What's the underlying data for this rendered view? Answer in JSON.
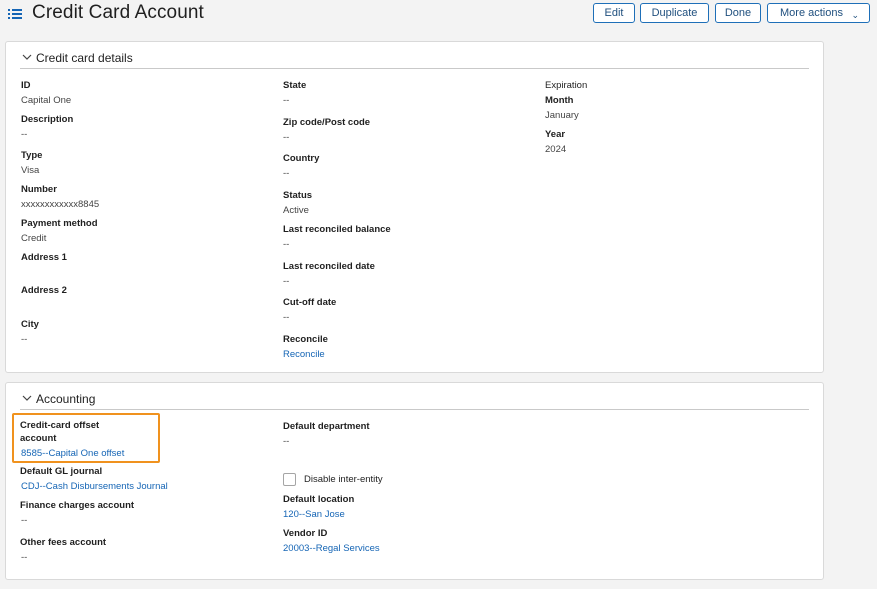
{
  "header": {
    "title": "Credit Card Account",
    "buttons": {
      "edit": "Edit",
      "duplicate": "Duplicate",
      "done": "Done",
      "more_actions": "More actions"
    }
  },
  "details": {
    "section_title": "Credit card details",
    "id": {
      "label": "ID",
      "value": "Capital One"
    },
    "description": {
      "label": "Description",
      "value": "--"
    },
    "type": {
      "label": "Type",
      "value": "Visa"
    },
    "number": {
      "label": "Number",
      "value": "xxxxxxxxxxxx8845"
    },
    "payment_method": {
      "label": "Payment method",
      "value": "Credit"
    },
    "address1": {
      "label": "Address 1"
    },
    "address2": {
      "label": "Address 2"
    },
    "city": {
      "label": "City",
      "value": "--"
    },
    "state": {
      "label": "State",
      "value": "--"
    },
    "zip": {
      "label": "Zip code/Post code",
      "value": "--"
    },
    "country": {
      "label": "Country",
      "value": "--"
    },
    "status": {
      "label": "Status",
      "value": "Active"
    },
    "last_reconciled_balance": {
      "label": "Last reconciled balance",
      "value": "--"
    },
    "last_reconciled_date": {
      "label": "Last reconciled date",
      "value": "--"
    },
    "cutoff_date": {
      "label": "Cut-off date",
      "value": "--"
    },
    "reconcile": {
      "label": "Reconcile",
      "value": "Reconcile"
    },
    "expiration": {
      "label": "Expiration"
    },
    "month": {
      "label": "Month",
      "value": "January"
    },
    "year": {
      "label": "Year",
      "value": "2024"
    }
  },
  "accounting": {
    "section_title": "Accounting",
    "offset_account": {
      "label_line1": "Credit-card offset",
      "label_line2": "account",
      "value": "8585--Capital One offset"
    },
    "gl_journal": {
      "label": "Default GL journal",
      "value": "CDJ--Cash Disbursements Journal"
    },
    "finance_charges": {
      "label": "Finance charges account",
      "value": "--"
    },
    "other_fees": {
      "label": "Other fees account",
      "value": "--"
    },
    "default_department": {
      "label": "Default department",
      "value": "--"
    },
    "disable_inter_entity": {
      "label": "Disable inter-entity",
      "checked": false
    },
    "default_location": {
      "label": "Default location",
      "value": "120--San Jose"
    },
    "vendor_id": {
      "label": "Vendor ID",
      "value": "20003--Regal Services"
    }
  },
  "colors": {
    "accent": "#1565b5",
    "highlight": "#f0921e"
  },
  "icons": {
    "menu": "list-menu-icon",
    "chevron": "chevron-down-icon"
  }
}
